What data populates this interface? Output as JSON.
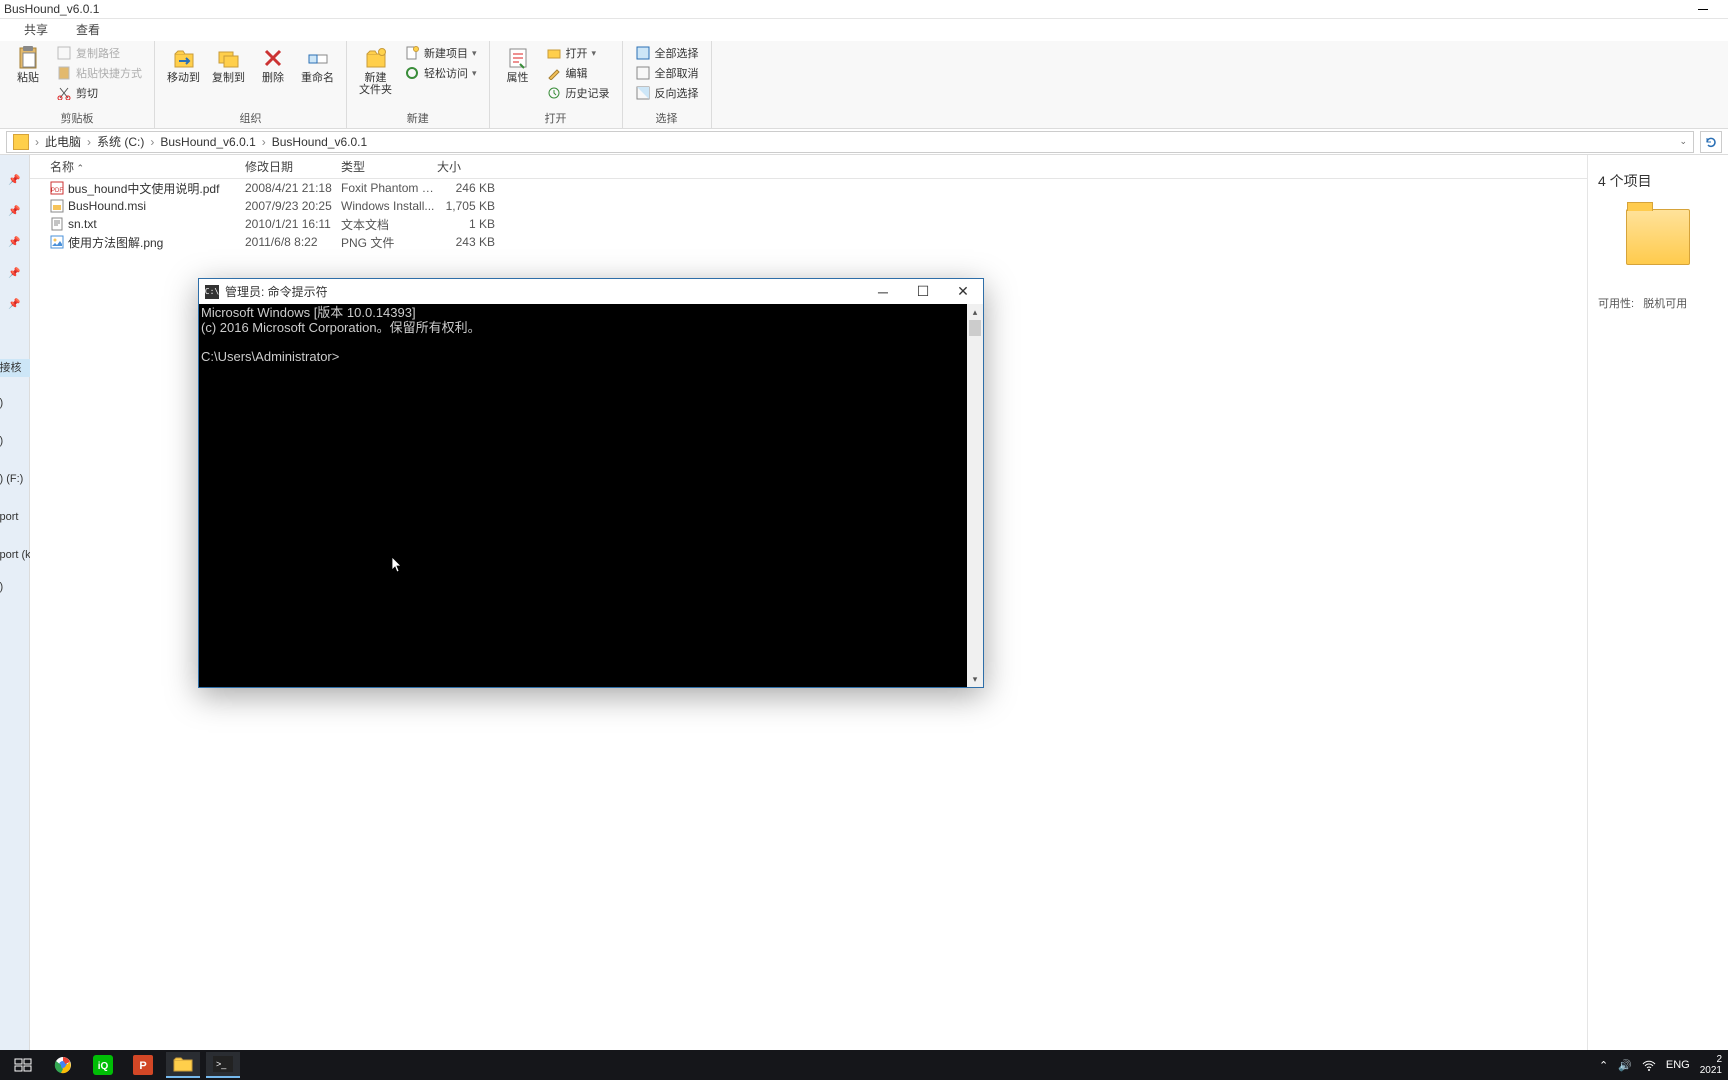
{
  "window": {
    "title": "BusHound_v6.0.1"
  },
  "tabs": {
    "share": "共享",
    "view": "查看"
  },
  "ribbon": {
    "clipboard": {
      "label": "剪贴板",
      "paste": "粘贴",
      "cut": "剪切",
      "copypath": "复制路径",
      "pasteshortcut": "粘贴快捷方式"
    },
    "organize": {
      "label": "组织",
      "moveto": "移动到",
      "copyto": "复制到",
      "delete": "删除",
      "rename": "重命名"
    },
    "new": {
      "label": "新建",
      "newfolder": "新建\n文件夹",
      "newitem": "新建项目",
      "easyaccess": "轻松访问"
    },
    "open": {
      "label": "打开",
      "properties": "属性",
      "open": "打开",
      "edit": "编辑",
      "history": "历史记录"
    },
    "select": {
      "label": "选择",
      "selectall": "全部选择",
      "selectnone": "全部取消",
      "invert": "反向选择"
    }
  },
  "breadcrumb": {
    "pc": "此电脑",
    "c": "系统 (C:)",
    "f1": "BusHound_v6.0.1",
    "f2": "BusHound_v6.0.1"
  },
  "columns": {
    "name": "名称",
    "date": "修改日期",
    "type": "类型",
    "size": "大小"
  },
  "files": [
    {
      "name": "bus_hound中文使用说明.pdf",
      "date": "2008/4/21 21:18",
      "type": "Foxit Phantom P...",
      "size": "246 KB",
      "icon": "pdf"
    },
    {
      "name": "BusHound.msi",
      "date": "2007/9/23 20:25",
      "type": "Windows Install...",
      "size": "1,705 KB",
      "icon": "msi"
    },
    {
      "name": "sn.txt",
      "date": "2010/1/21 16:11",
      "type": "文本文档",
      "size": "1 KB",
      "icon": "txt"
    },
    {
      "name": "使用方法图解.png",
      "date": "2011/6/8 8:22",
      "type": "PNG 文件",
      "size": "243 KB",
      "icon": "png"
    }
  ],
  "details": {
    "count": "4 个项目",
    "avail_label": "可用性:",
    "avail_value": "脱机可用"
  },
  "sidebar_fragments": [
    ")",
    "接核",
    ")",
    ")",
    ")",
    ")",
    ") (F:)",
    ")",
    "port",
    ";)",
    "port (k"
  ],
  "cmd": {
    "title": "管理员: 命令提示符",
    "line1": "Microsoft Windows [版本 10.0.14393]",
    "line2": "(c) 2016 Microsoft Corporation。保留所有权利。",
    "prompt": "C:\\Users\\Administrator>"
  },
  "tray": {
    "lang": "ENG",
    "time_top": "2",
    "time_bottom": "2021"
  }
}
